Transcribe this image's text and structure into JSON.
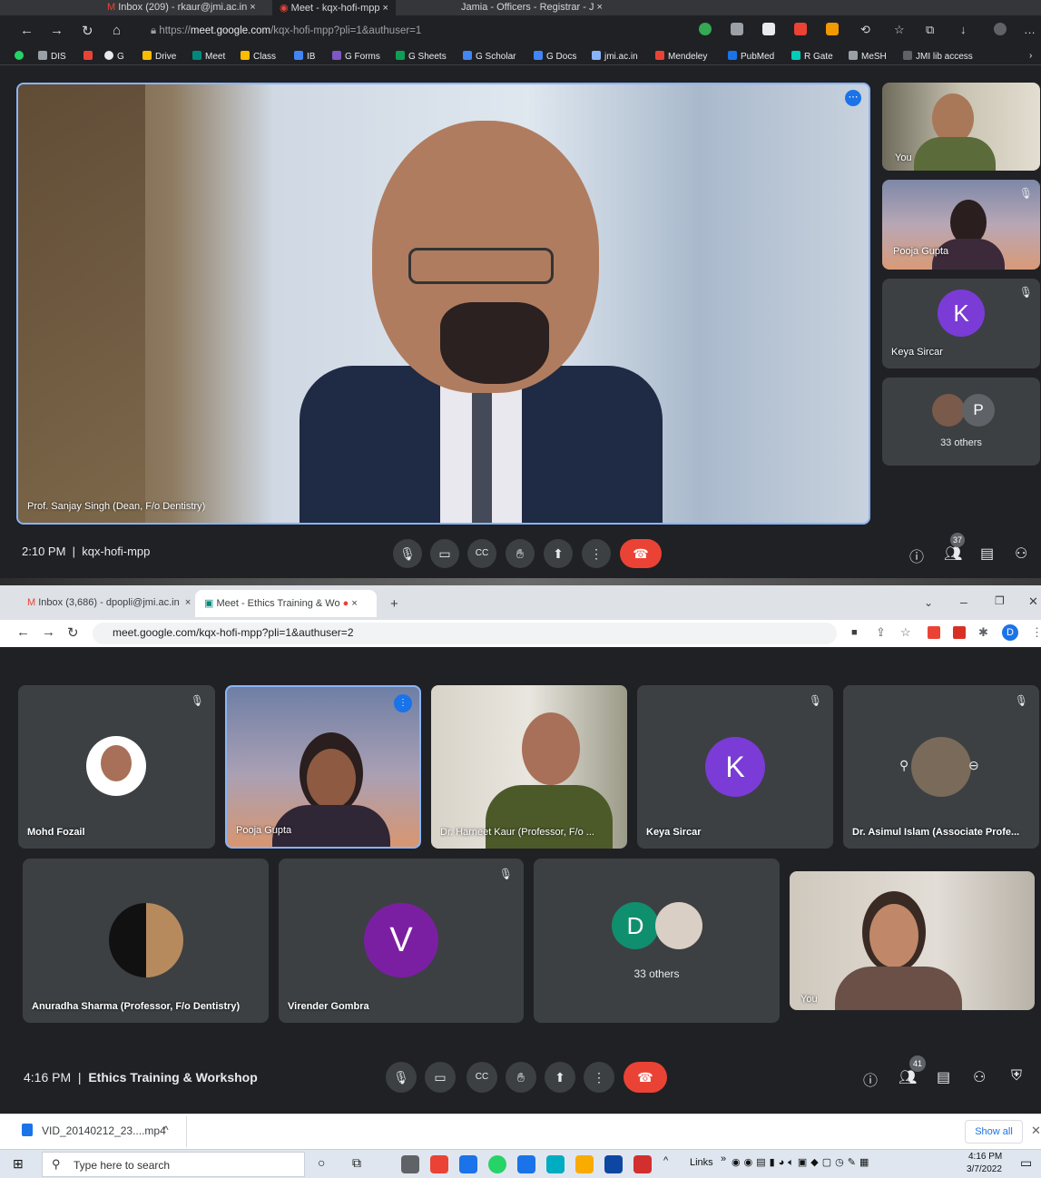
{
  "top_window": {
    "tabs": [
      {
        "label": "Inbox (209) - rkaur@jmi.ac.in"
      },
      {
        "label": "Meet - kqx-hofi-mpp"
      },
      {
        "label": "Jamia - Officers - Registrar - J"
      }
    ],
    "url_prefix": "https://",
    "url_domain": "meet.google.com",
    "url_path": "/kqx-hofi-mpp?pli=1&authuser=1",
    "bookmarks": [
      "DIS",
      "G",
      "Drive",
      "Meet",
      "Class",
      "IB",
      "G Forms",
      "G Sheets",
      "G Scholar",
      "G Docs",
      "jmi.ac.in",
      "Mendeley",
      "PubMed",
      "R Gate",
      "MeSH",
      "JMI lib access"
    ],
    "main_speaker": "Prof. Sanjay Singh (Dean, F/o Dentistry)",
    "side_tiles": [
      {
        "name": "You"
      },
      {
        "name": "Pooja Gupta"
      },
      {
        "name": "Keya Sircar",
        "initial": "K"
      },
      {
        "name": "33 others",
        "initial": "P"
      }
    ],
    "time": "2:10 PM",
    "meeting_code": "kqx-hofi-mpp",
    "participant_count": "37"
  },
  "bottom_window": {
    "tabs": [
      {
        "label": "Inbox (3,686) - dpopli@jmi.ac.in"
      },
      {
        "label": "Meet - Ethics Training & Wo"
      }
    ],
    "url": "meet.google.com/kqx-hofi-mpp?pli=1&authuser=2",
    "profile_initial": "D",
    "tiles_row1": [
      {
        "name": "Mohd Fozail"
      },
      {
        "name": "Pooja Gupta"
      },
      {
        "name": "Dr. Harneet Kaur (Professor, F/o ..."
      },
      {
        "name": "Keya Sircar",
        "initial": "K"
      },
      {
        "name": "Dr. Asimul Islam (Associate Profe..."
      }
    ],
    "tiles_row2": [
      {
        "name": "Anuradha Sharma (Professor, F/o Dentistry)"
      },
      {
        "name": "Virender Gombra",
        "initial": "V"
      },
      {
        "name": "33 others",
        "initial": "D"
      },
      {
        "name": "You"
      }
    ],
    "time": "4:16 PM",
    "meeting_title": "Ethics Training & Workshop",
    "participant_count": "41"
  },
  "download_bar": {
    "file": "VID_20140212_23....mp4",
    "show_all": "Show all"
  },
  "taskbar": {
    "search_placeholder": "Type here to search",
    "links": "Links",
    "time": "4:16 PM",
    "date": "3/7/2022"
  }
}
